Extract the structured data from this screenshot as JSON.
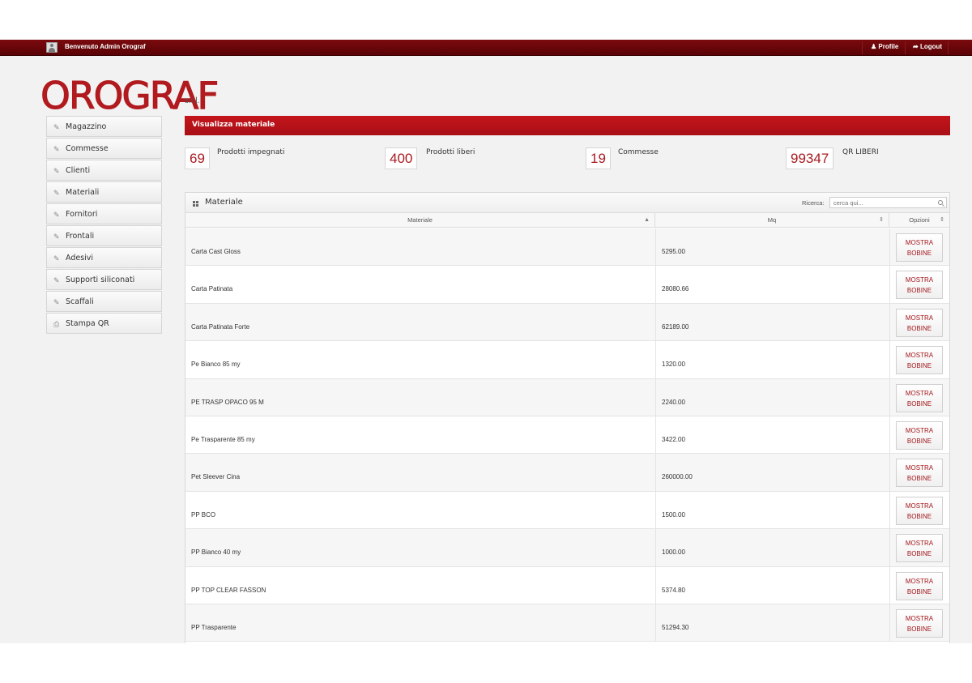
{
  "topbar": {
    "welcome": "Benvenuto Admin Orograf",
    "profile": "Profile",
    "logout": "Logout"
  },
  "logo": {
    "name": "OROGRAF",
    "suffix": "s.r.l."
  },
  "sidebar": {
    "items": [
      {
        "label": "Magazzino",
        "icon": "pencil-icon"
      },
      {
        "label": "Commesse",
        "icon": "pencil-icon"
      },
      {
        "label": "Clienti",
        "icon": "pencil-icon"
      },
      {
        "label": "Materiali",
        "icon": "pencil-icon"
      },
      {
        "label": "Fornitori",
        "icon": "pencil-icon"
      },
      {
        "label": "Frontali",
        "icon": "pencil-icon"
      },
      {
        "label": "Adesivi",
        "icon": "pencil-icon"
      },
      {
        "label": "Supporti siliconati",
        "icon": "pencil-icon"
      },
      {
        "label": "Scaffali",
        "icon": "pencil-icon"
      },
      {
        "label": "Stampa QR",
        "icon": "printer-icon"
      }
    ]
  },
  "main": {
    "title": "Visualizza materiale",
    "stats": [
      {
        "value": "69",
        "label": "Prodotti impegnati"
      },
      {
        "value": "400",
        "label": "Prodotti liberi"
      },
      {
        "value": "19",
        "label": "Commesse"
      },
      {
        "value": "99347",
        "label": "QR LIBERI"
      }
    ]
  },
  "panel": {
    "title": "Materiale",
    "search_label": "Ricerca:",
    "search_placeholder": "cerca qui...",
    "columns": [
      "Materiale",
      "Mq",
      "Opzioni"
    ],
    "button_line1": "MOSTRA",
    "button_line2": "BOBINE",
    "rows": [
      {
        "materiale": "Carta Cast Gloss",
        "mq": "5295.00"
      },
      {
        "materiale": "Carta Patinata",
        "mq": "28080.66"
      },
      {
        "materiale": "Carta Patinata Forte",
        "mq": "62189.00"
      },
      {
        "materiale": "Pe Bianco 85 my",
        "mq": "1320.00"
      },
      {
        "materiale": "PE TRASP OPACO 95 M",
        "mq": "2240.00"
      },
      {
        "materiale": "Pe Trasparente 85 my",
        "mq": "3422.00"
      },
      {
        "materiale": "Pet Sleever Cina",
        "mq": "260000.00"
      },
      {
        "materiale": "PP BCO",
        "mq": "1500.00"
      },
      {
        "materiale": "PP Bianco 40 my",
        "mq": "1000.00"
      },
      {
        "materiale": "PP TOP CLEAR FASSON",
        "mq": "5374.80"
      },
      {
        "materiale": "PP Trasparente",
        "mq": "51294.30"
      }
    ]
  },
  "colors": {
    "brand": "#b11a1f",
    "topbar": "#6a0508",
    "header": "#c4151c"
  }
}
